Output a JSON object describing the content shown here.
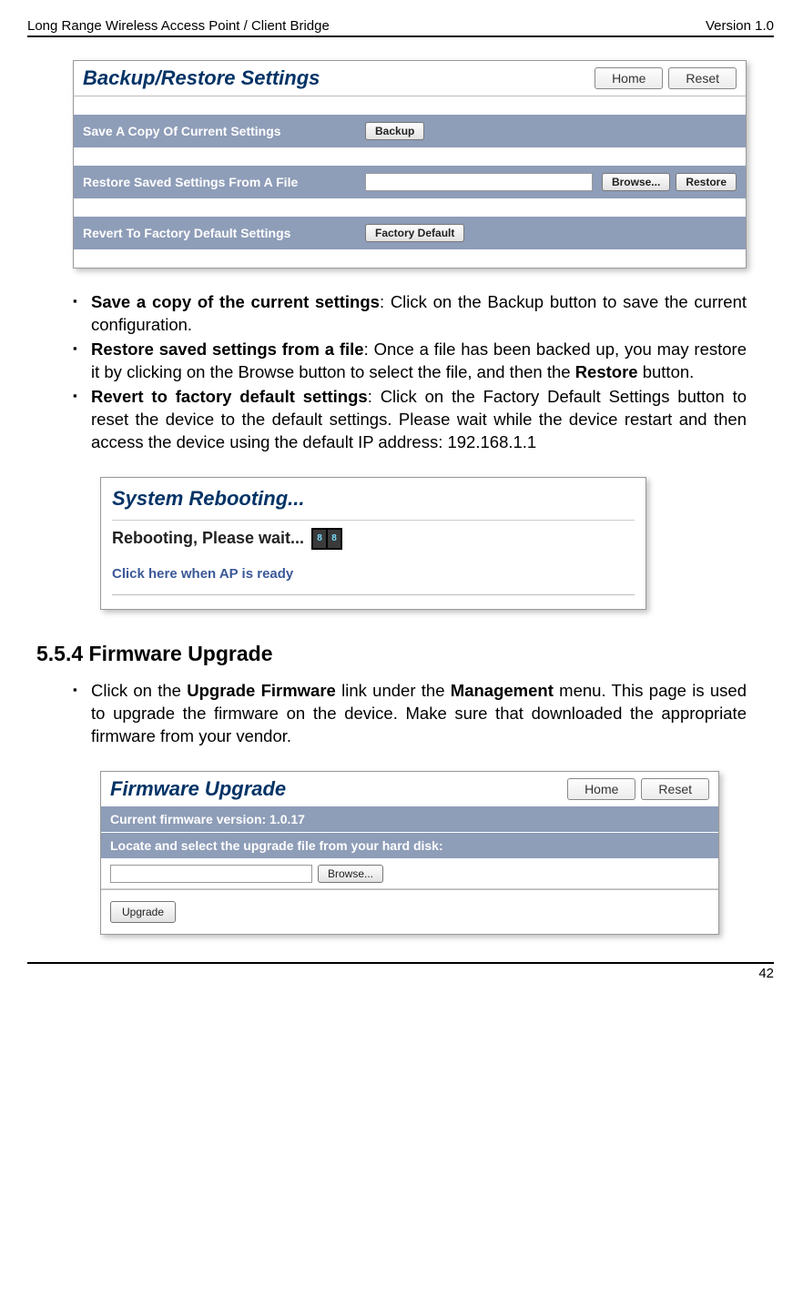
{
  "header": {
    "left": "Long Range Wireless Access Point / Client Bridge",
    "right": "Version 1.0"
  },
  "page_number": "42",
  "backup_panel": {
    "title": "Backup/Restore Settings",
    "home_btn": "Home",
    "reset_btn": "Reset",
    "row_save": "Save A Copy Of Current Settings",
    "backup_btn": "Backup",
    "row_restore": "Restore Saved Settings From A File",
    "browse_btn": "Browse...",
    "restore_btn": "Restore",
    "row_revert": "Revert To Factory Default Settings",
    "factory_btn": "Factory Default"
  },
  "bullets": {
    "b1_bold": "Save a copy of the current settings",
    "b1_rest": ": Click on the Backup button to save the current configuration.",
    "b2_bold": "Restore saved settings from a file",
    "b2_rest": ": Once a file has been backed up, you may restore it by clicking on the Browse button to select the file, and then the ",
    "b2_bold2": "Restore",
    "b2_rest2": " button.",
    "b3_bold": "Revert to factory default settings",
    "b3_rest": ": Click on the Factory Default Settings button to reset the device to the default settings. Please wait while the device restart and then access the device using the default IP address: 192.168.1.1"
  },
  "reboot": {
    "title": "System Rebooting...",
    "wait": "Rebooting, Please wait...",
    "link": "Click here when AP is ready"
  },
  "section": "5.5.4 Firmware Upgrade",
  "fw_bullet": {
    "pre": "Click on the ",
    "b1": "Upgrade Firmware",
    "mid": " link under the ",
    "b2": "Management",
    "post": " menu. This page is used to upgrade the firmware on the device. Make sure that downloaded the appropriate firmware from your vendor."
  },
  "fw_panel": {
    "title": "Firmware Upgrade",
    "home_btn": "Home",
    "reset_btn": "Reset",
    "version": "Current firmware version: 1.0.17",
    "locate": "Locate and select the upgrade file from your hard disk:",
    "browse_btn": "Browse...",
    "upgrade_btn": "Upgrade"
  }
}
